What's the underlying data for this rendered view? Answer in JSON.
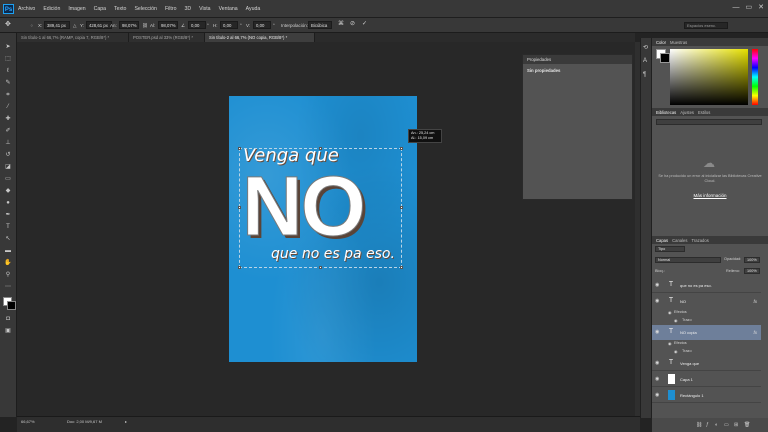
{
  "app": {
    "logo": "Ps"
  },
  "menu": [
    "Archivo",
    "Edición",
    "Imagen",
    "Capa",
    "Texto",
    "Selección",
    "Filtro",
    "3D",
    "Vista",
    "Ventana",
    "Ayuda"
  ],
  "window_controls": [
    "—",
    "▭",
    "✕"
  ],
  "options": {
    "tool_icon": "move-crosshair-icon",
    "x_label": "X:",
    "x_value": "389,41 px",
    "y_label": "Y:",
    "y_value": "428,61 px",
    "w_label": "An:",
    "w_value": "98,07%",
    "h_label": "Al:",
    "h_value": "98,07%",
    "angle_value": "0,00",
    "angle_unit": "°",
    "h_skew_label": "H:",
    "h_skew_value": "0,00",
    "v_skew_label": "V:",
    "v_skew_value": "0,00",
    "interp_label": "Interpolación:",
    "interp_value": "Bicúbica",
    "search_placeholder": "Espacios esenc."
  },
  "tabs": [
    {
      "label": "Sin título-1 al 66,7% (RAMP, copia 7, RGB/8*) *",
      "active": false
    },
    {
      "label": "POSTER.psd al 33% (RGB/8*) *",
      "active": false
    },
    {
      "label": "Sin título-2 al 66,7% (NO copia, RGB/8*) *",
      "active": true
    }
  ],
  "canvas": {
    "line1": "Venga que",
    "line2": "NO",
    "line3": "que no es pa eso.",
    "bg_color": "#1e8fd2"
  },
  "dimension_tip": {
    "w_label": "An.:",
    "w_value": "25,24 cm",
    "h_label": "Al.:",
    "h_value": "15,09 cm"
  },
  "properties": {
    "title": "Propiedades",
    "subtitle": "Sin propiedades"
  },
  "color_panel": {
    "tabs": [
      {
        "label": "Color",
        "active": true
      },
      {
        "label": "Muestras",
        "active": false
      }
    ]
  },
  "library_panel": {
    "tabs": [
      {
        "label": "Bibliotecas",
        "active": true
      },
      {
        "label": "Ajustes",
        "active": false
      },
      {
        "label": "Estilos",
        "active": false
      }
    ],
    "message": "Se ha producido un error al inicializar las Bibliotecas Creative Cloud.",
    "link": "Más información"
  },
  "layers_panel": {
    "tabs": [
      {
        "label": "Capas",
        "active": true
      },
      {
        "label": "Canales",
        "active": false
      },
      {
        "label": "Trazados",
        "active": false
      }
    ],
    "filter": "Tipo",
    "blend_mode": "Normal",
    "opacity_label": "Opacidad:",
    "opacity_value": "100%",
    "lock_label": "Bloq.:",
    "fill_label": "Relleno:",
    "fill_value": "100%",
    "layers": [
      {
        "name": "que no es pa eso.",
        "kind": "T",
        "fx": "",
        "selected": false
      },
      {
        "name": "NO",
        "kind": "T",
        "fx": "fx",
        "selected": false
      },
      {
        "name": "NO copia",
        "kind": "T",
        "fx": "fx",
        "selected": true
      },
      {
        "name": "Venga que",
        "kind": "T",
        "fx": "",
        "selected": false
      },
      {
        "name": "Capa 1",
        "kind": "img",
        "fx": "",
        "selected": false
      },
      {
        "name": "Rectángulo 1",
        "kind": "rect",
        "fx": "",
        "selected": false
      }
    ],
    "effects_label": "Efectos",
    "stroke_label": "Trazo"
  },
  "status": {
    "zoom": "66,67%",
    "doc": "Doc: 2,00 M/9,67 M"
  }
}
